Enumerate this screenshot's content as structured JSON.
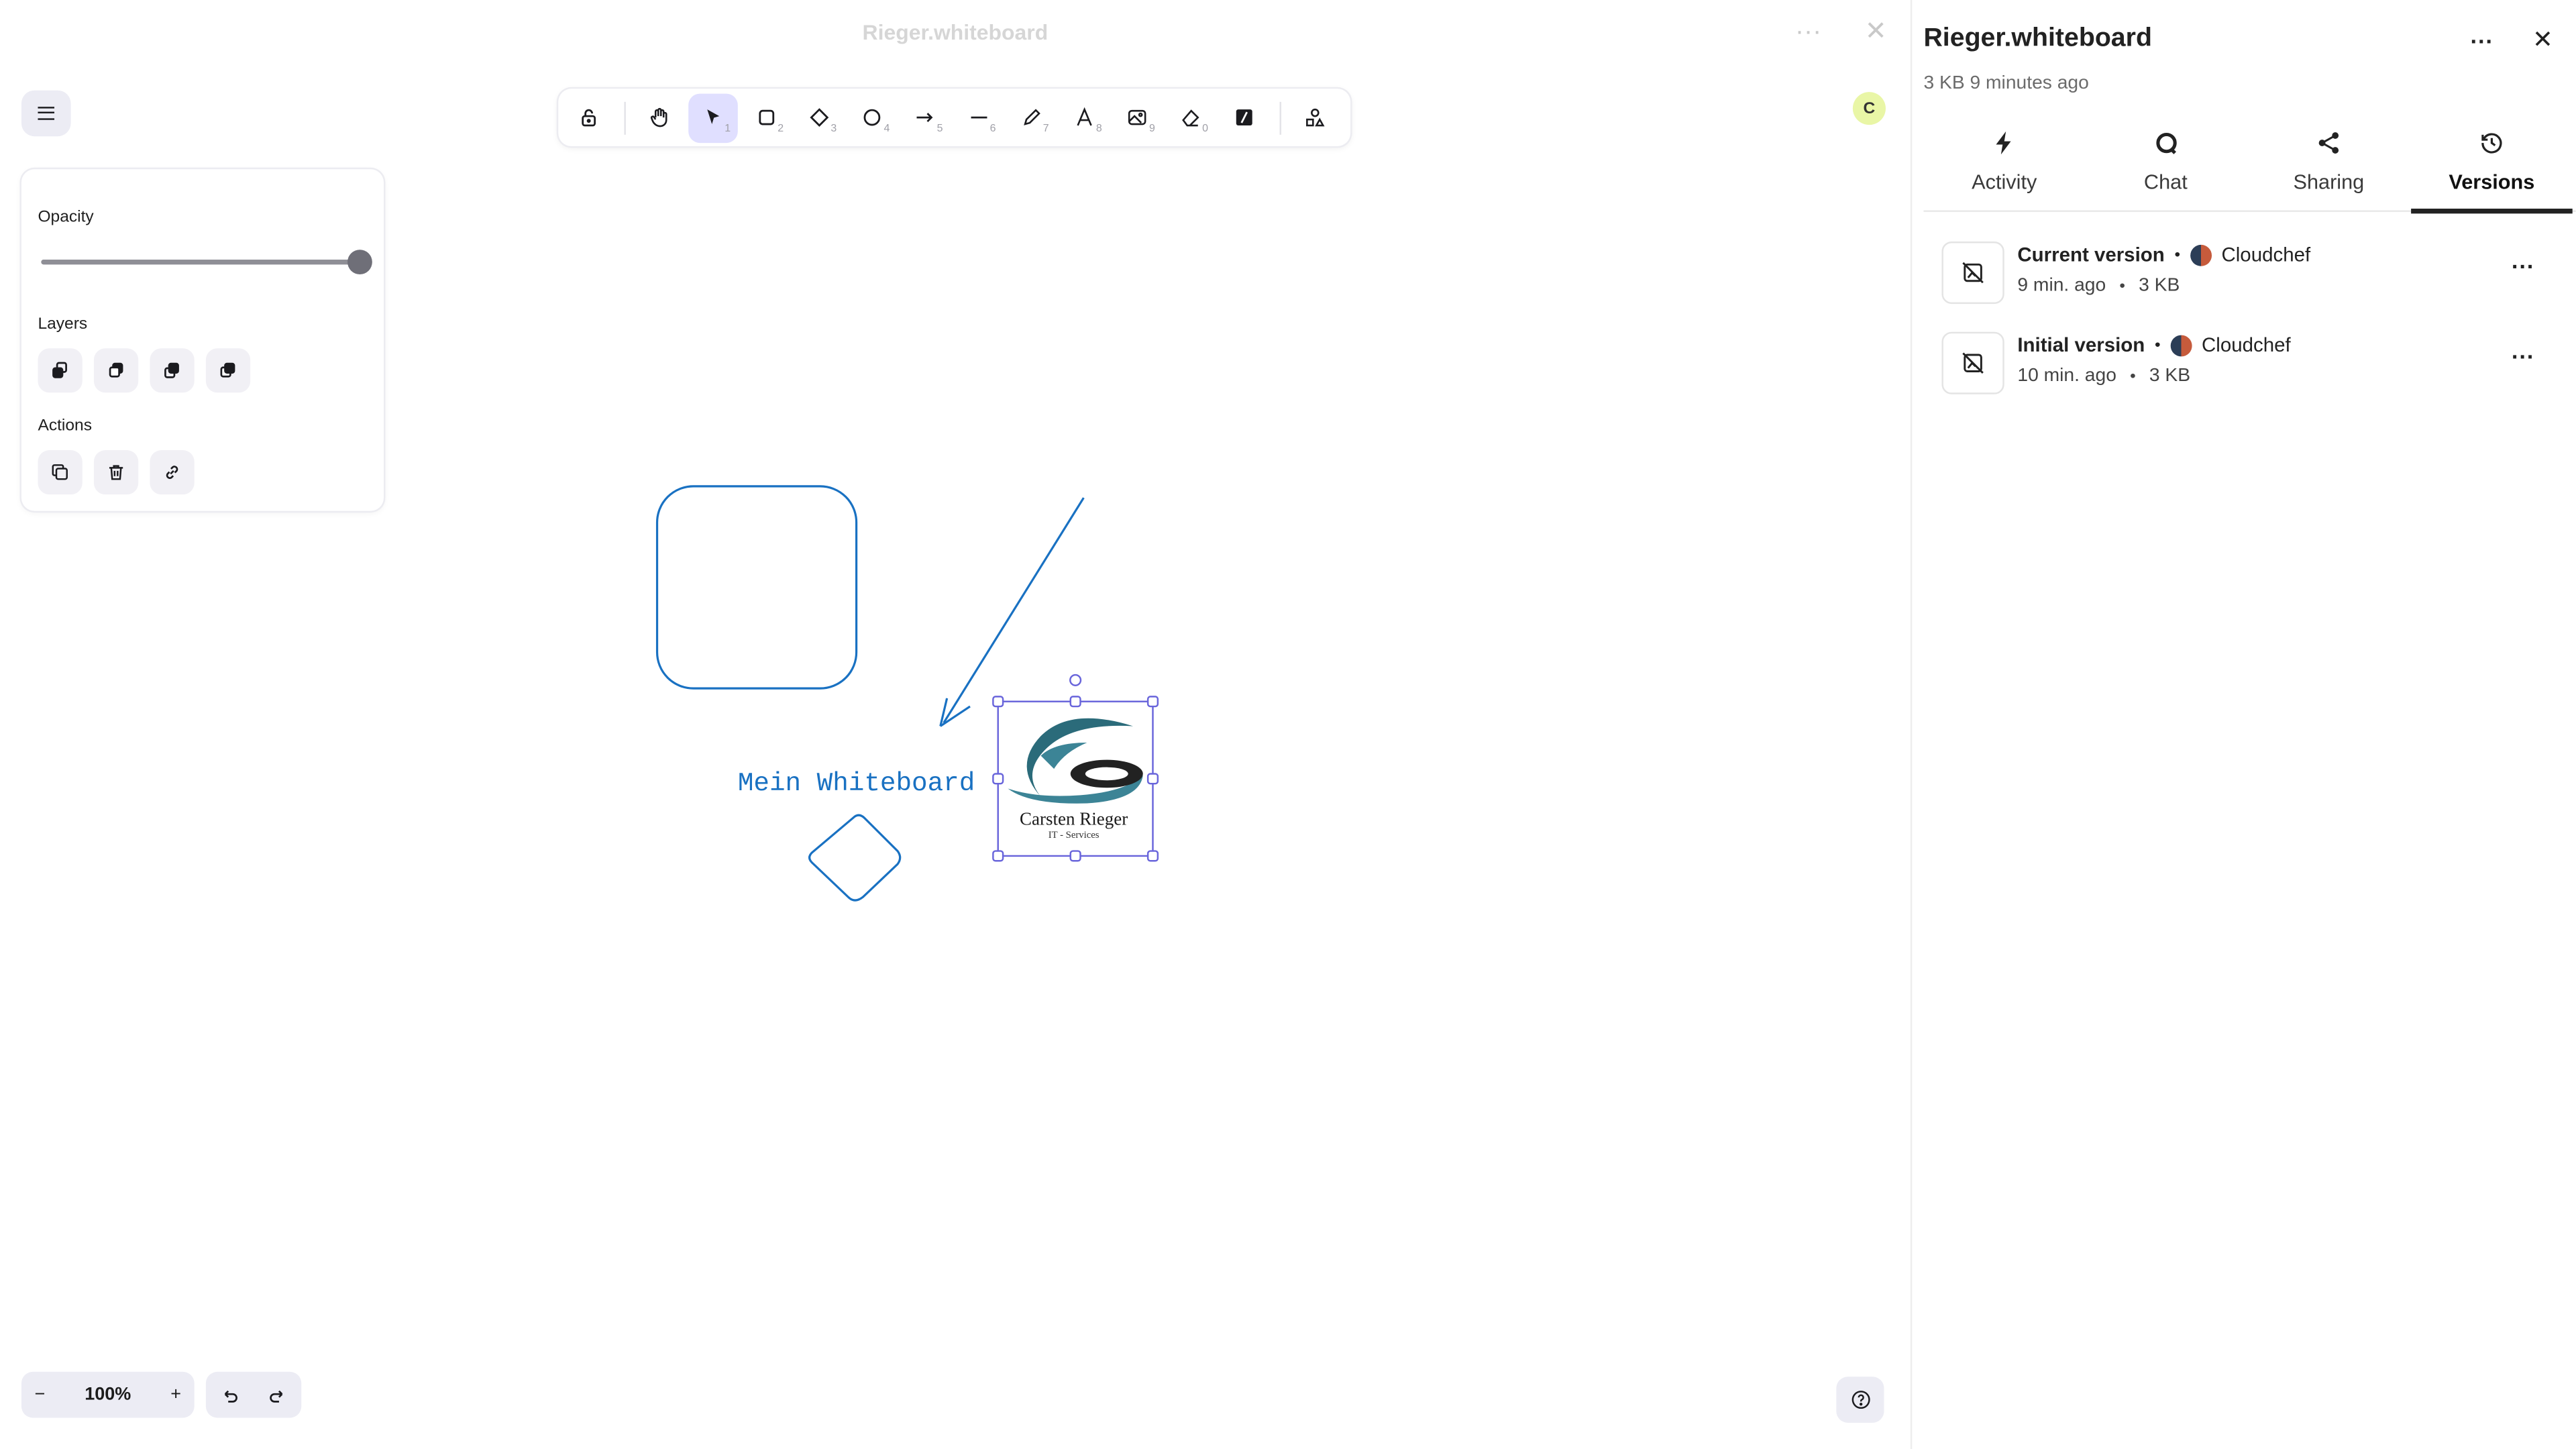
{
  "canvas": {
    "doc_title": "Rieger.whiteboard",
    "whiteboard_text": "Mein Whiteboard",
    "logo": {
      "name": "Carsten Rieger",
      "tagline": "IT - Services"
    },
    "collaborator_initial": "C"
  },
  "toolbar": {
    "tools": [
      {
        "name": "lock",
        "key": ""
      },
      {
        "name": "hand",
        "key": ""
      },
      {
        "name": "selection",
        "key": "1",
        "active": true
      },
      {
        "name": "rectangle",
        "key": "2"
      },
      {
        "name": "diamond",
        "key": "3"
      },
      {
        "name": "ellipse",
        "key": "4"
      },
      {
        "name": "arrow",
        "key": "5"
      },
      {
        "name": "line",
        "key": "6"
      },
      {
        "name": "draw",
        "key": "7"
      },
      {
        "name": "text",
        "key": "8"
      },
      {
        "name": "image",
        "key": "9"
      },
      {
        "name": "eraser",
        "key": "0"
      },
      {
        "name": "frame",
        "key": ""
      },
      {
        "name": "library",
        "key": ""
      }
    ]
  },
  "properties": {
    "opacity_label": "Opacity",
    "opacity_value": 100,
    "layers_label": "Layers",
    "actions_label": "Actions"
  },
  "footer": {
    "zoom_out": "−",
    "zoom_level": "100%",
    "zoom_in": "+"
  },
  "sidebar": {
    "title": "Rieger.whiteboard",
    "subtitle": "3 KB 9 minutes ago",
    "tabs": [
      {
        "label": "Activity",
        "icon": "lightning-icon"
      },
      {
        "label": "Chat",
        "icon": "chat-icon"
      },
      {
        "label": "Sharing",
        "icon": "share-icon"
      },
      {
        "label": "Versions",
        "icon": "history-icon",
        "active": true
      }
    ],
    "versions": [
      {
        "name": "Current version",
        "author": "Cloudchef",
        "time": "9 min. ago",
        "size": "3 KB"
      },
      {
        "name": "Initial version",
        "author": "Cloudchef",
        "time": "10 min. ago",
        "size": "3 KB"
      }
    ],
    "separator": "•"
  },
  "colors": {
    "stroke": "#1971c2",
    "selection": "#6965db",
    "toolbar_active": "#e0dfff",
    "logo_teal": "#2b6b7a"
  }
}
